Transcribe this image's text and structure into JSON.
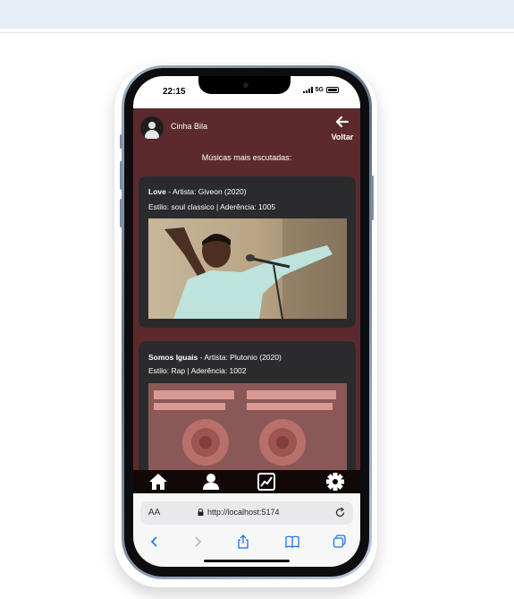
{
  "status": {
    "time": "22:15",
    "network": "5G"
  },
  "header": {
    "user_name": "Cinha Bila",
    "back_label": "Voltar"
  },
  "section_title": "Músicas mais escutadas:",
  "songs": [
    {
      "title": "Love",
      "artist_line": "- Artista: Giveon (2020)",
      "style_line": "Estilo: soul classico | Aderência: 1005"
    },
    {
      "title": "Somos Iguais",
      "artist_line": "- Artista: Plutonio (2020)",
      "style_line": "Estilo: Rap | Aderência: 1002"
    }
  ],
  "browser": {
    "aa_label": "AA",
    "url": "http://localhost:5174"
  },
  "colors": {
    "app_background": "#5c2a2c",
    "card_background": "#2b2a2c",
    "nav_background": "#120808",
    "accent_blue": "#1a73e8"
  },
  "icons": {
    "nav": [
      "home-icon",
      "user-icon",
      "chart-icon",
      "gear-icon"
    ],
    "toolbar": [
      "back-icon",
      "forward-icon",
      "share-icon",
      "bookmarks-icon",
      "tabs-icon"
    ]
  }
}
